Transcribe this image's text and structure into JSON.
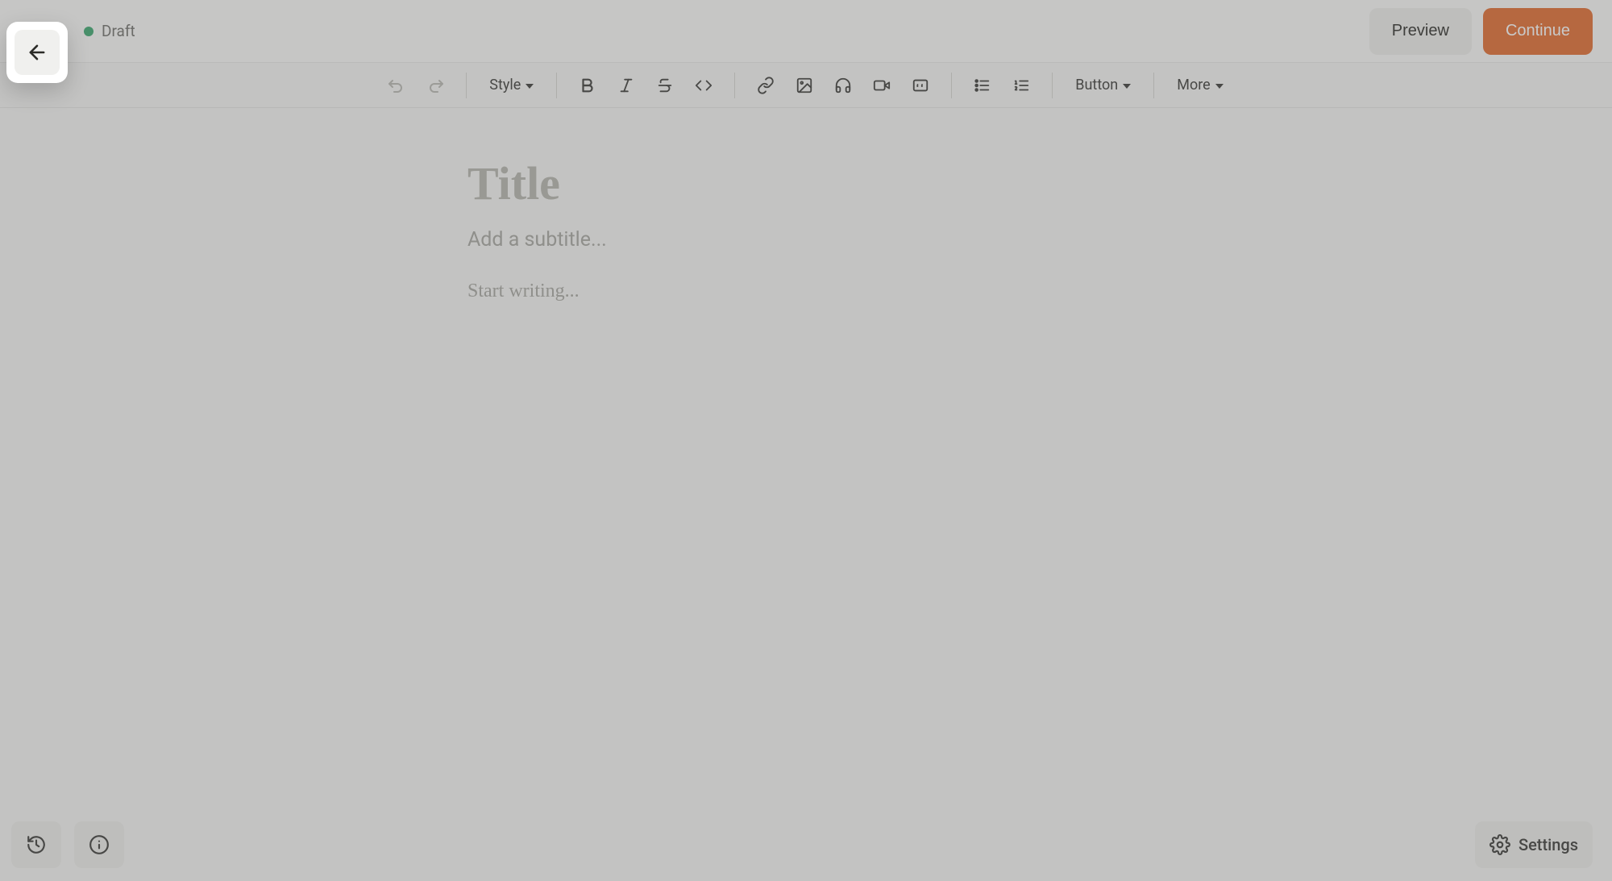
{
  "header": {
    "status_label": "Draft",
    "status_color": "#3aa76d",
    "preview_button": "Preview",
    "continue_button": "Continue"
  },
  "toolbar": {
    "style_label": "Style",
    "button_label": "Button",
    "more_label": "More"
  },
  "editor": {
    "title_placeholder": "Title",
    "subtitle_placeholder": "Add a subtitle...",
    "body_placeholder": "Start writing..."
  },
  "footer": {
    "settings_label": "Settings"
  },
  "colors": {
    "accent": "#e26b2d",
    "background": "#f6f6f4",
    "text_muted": "#a6a6a0"
  }
}
